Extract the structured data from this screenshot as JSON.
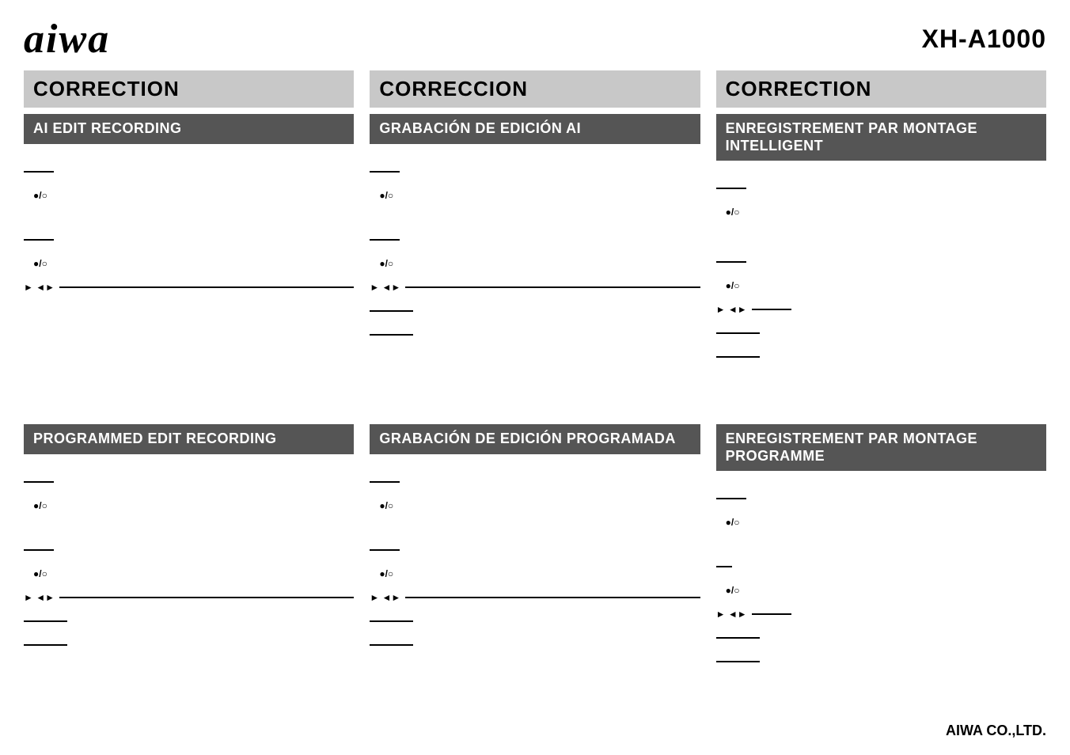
{
  "header": {
    "logo": "aiwa",
    "model": "XH-A1000"
  },
  "columns": [
    {
      "id": "english",
      "correction_label": "CORRECTION",
      "sections": [
        {
          "id": "ai-edit",
          "title": "AI EDIT RECORDING",
          "title_lines": [
            "AI EDIT RECORDING"
          ],
          "dark": true
        },
        {
          "id": "prog-edit",
          "title": "PROGRAMMED EDIT RECORDING",
          "title_lines": [
            "PROGRAMMED EDIT",
            "RECORDING"
          ],
          "dark": true
        }
      ]
    },
    {
      "id": "spanish",
      "correction_label": "CORRECCION",
      "sections": [
        {
          "id": "ai-edit-es",
          "title": "GRABACIÓN DE EDICIÓN AI",
          "title_lines": [
            "GRABACIÓN DE EDICIÓN AI"
          ],
          "dark": true
        },
        {
          "id": "prog-edit-es",
          "title": "GRABACIÓN DE EDICIÓN PROGRAMADA",
          "title_lines": [
            "GRABACIÓN DE EDICIÓN",
            "PROGRAMADA"
          ],
          "dark": true
        }
      ]
    },
    {
      "id": "french",
      "correction_label": "CORRECTION",
      "sections": [
        {
          "id": "ai-edit-fr",
          "title": "ENREGISTREMENT PAR MONTAGE INTELLIGENT",
          "title_lines": [
            "ENREGISTREMENT PAR",
            "MONTAGE INTELLIGENT"
          ],
          "dark": true
        },
        {
          "id": "prog-edit-fr",
          "title": "ENREGISTREMENT PAR MONTAGE PROGRAMME",
          "title_lines": [
            "ENREGISTREMENT PAR",
            "MONTAGE PROGRAMME"
          ],
          "dark": true
        }
      ]
    }
  ],
  "footer": {
    "company": "AIWA CO.,LTD."
  },
  "symbols": {
    "bullet_o": "●/○",
    "play_back": "► ◄►"
  }
}
